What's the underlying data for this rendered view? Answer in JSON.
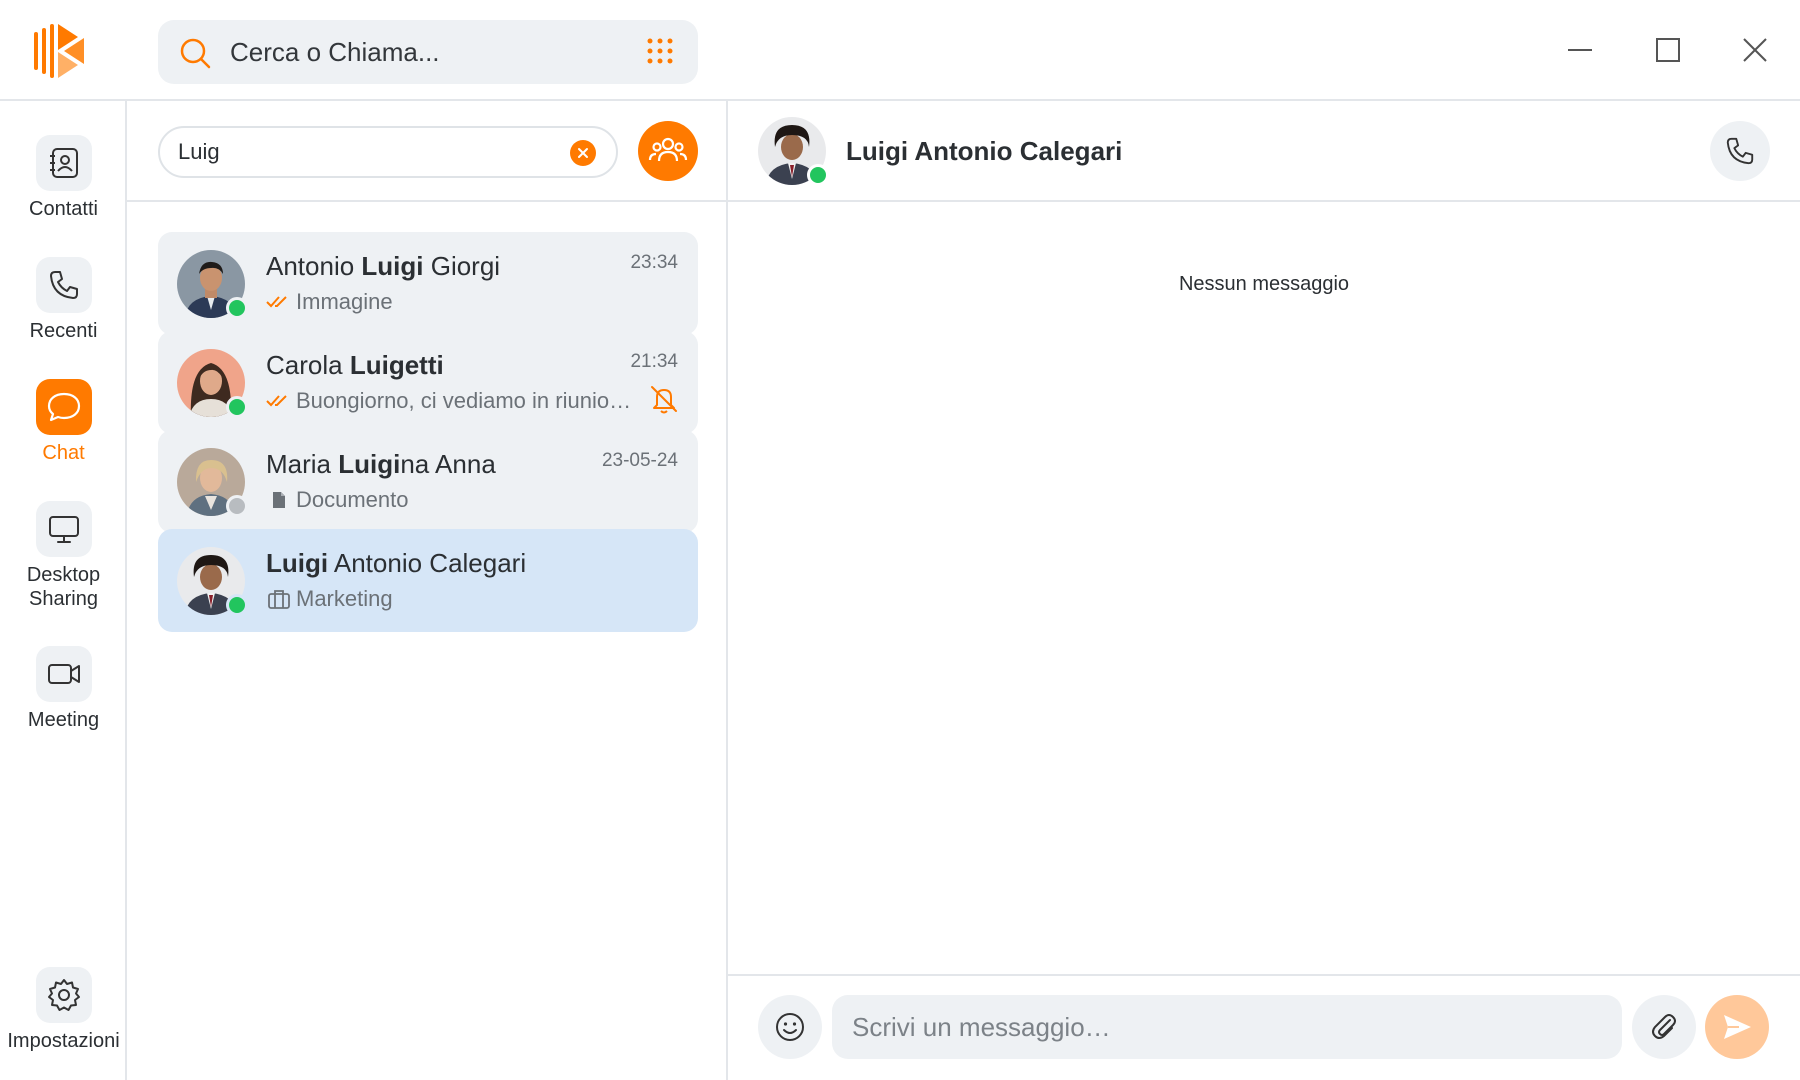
{
  "app": {
    "logo_icon": "brand-logo-icon",
    "accent_color": "#ff7a00",
    "online_color": "#22c55e",
    "offline_color": "#b8bcc0"
  },
  "header": {
    "search_text": "Cerca o Chiama...",
    "search_icon": "search-icon",
    "dialpad_icon": "dialpad-icon",
    "window_controls": [
      "minimize-icon",
      "maximize-icon",
      "close-icon"
    ]
  },
  "sidebar": {
    "items": [
      {
        "label": "Contatti",
        "icon": "contacts-icon",
        "active": false
      },
      {
        "label": "Recenti",
        "icon": "phone-icon",
        "active": false
      },
      {
        "label": "Chat",
        "icon": "chat-bubble-icon",
        "active": true
      },
      {
        "label": "Desktop\nSharing",
        "icon": "monitor-icon",
        "active": false
      },
      {
        "label": "Meeting",
        "icon": "video-icon",
        "active": false
      }
    ],
    "settings": {
      "label": "Impostazioni",
      "icon": "gear-icon"
    }
  },
  "chat_list": {
    "filter_value": "Luig",
    "items": [
      {
        "name_pre": "Antonio ",
        "name_match": "Luigi",
        "name_post": " Giorgi",
        "time": "23:34",
        "subtitle": "Immagine",
        "subtitle_icon": "double-check-icon",
        "status": "online",
        "muted": false
      },
      {
        "name_pre": "Carola ",
        "name_match": "Luigetti",
        "name_post": "",
        "time": "21:34",
        "subtitle": "Buongiorno, ci vediamo in riunion…",
        "subtitle_icon": "double-check-icon",
        "status": "online",
        "muted": true
      },
      {
        "name_pre": "Maria ",
        "name_match": "Luigi",
        "name_post": "na Anna",
        "time": "23-05-24",
        "subtitle": "Documento",
        "subtitle_icon": "document-icon",
        "status": "offline",
        "muted": false
      },
      {
        "name_pre": "",
        "name_match": "Luigi",
        "name_post": " Antonio Calegari",
        "time": "",
        "subtitle": "Marketing",
        "subtitle_icon": "briefcase-icon",
        "status": "online",
        "muted": false,
        "selected": true
      }
    ]
  },
  "conversation": {
    "title": "Luigi Antonio Calegari",
    "empty_text": "Nessun messaggio",
    "composer": {
      "placeholder": "Scrivi un messaggio…",
      "emoji_icon": "emoji-icon",
      "attach_icon": "paperclip-icon",
      "send_icon": "send-icon"
    }
  }
}
